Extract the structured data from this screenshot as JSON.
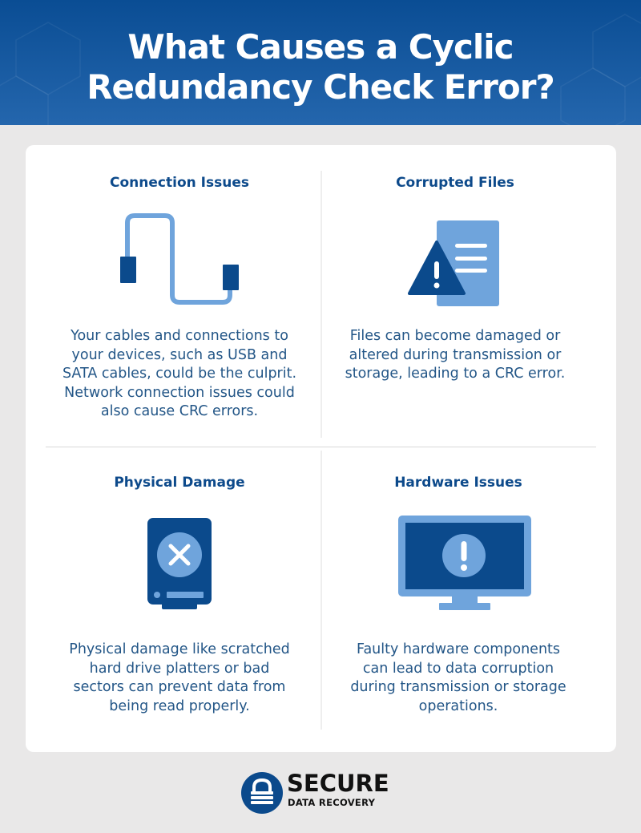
{
  "header": {
    "title_line1": "What Causes a Cyclic",
    "title_line2": "Redundancy Check Error?"
  },
  "colors": {
    "header_blue": "#0a4d94",
    "heading_blue": "#0d4a8b",
    "body_text": "#235687",
    "icon_dark": "#0b4a8c",
    "icon_light": "#6fa4dc",
    "page_bg": "#e9e8e8"
  },
  "causes": [
    {
      "heading": "Connection Issues",
      "icon": "cable-icon",
      "lines": [
        "Your cables and connections to",
        "your devices, such as USB and",
        "SATA cables, could be the culprit.",
        "Network connection issues could",
        "also cause CRC errors."
      ]
    },
    {
      "heading": "Corrupted Files",
      "icon": "corrupted-file-warning-icon",
      "lines": [
        "Files can become damaged or",
        "altered during transmission or",
        "storage, leading to a CRC error."
      ]
    },
    {
      "heading": "Physical Damage",
      "icon": "damaged-hard-drive-icon",
      "lines": [
        "Physical damage like scratched",
        "hard drive platters or bad",
        "sectors can prevent data from",
        "being read properly."
      ]
    },
    {
      "heading": "Hardware Issues",
      "icon": "monitor-alert-icon",
      "lines": [
        "Faulty hardware components",
        "can lead to data corruption",
        "during transmission or storage",
        "operations."
      ]
    }
  ],
  "footer": {
    "brand_line1": "SECURE",
    "brand_line2": "DATA RECOVERY",
    "logo_icon": "padlock-icon"
  }
}
